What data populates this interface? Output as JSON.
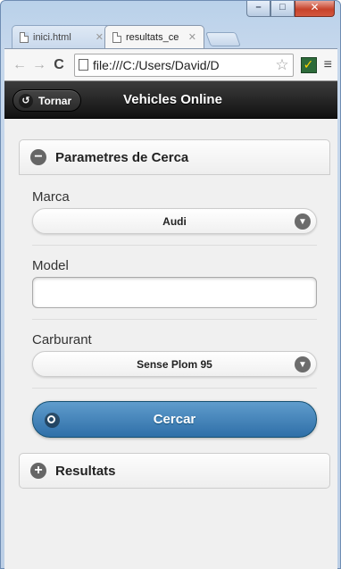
{
  "browser": {
    "tabs": [
      {
        "title": "inici.html",
        "active": false
      },
      {
        "title": "resultats_ce",
        "active": true
      }
    ],
    "url": "file:///C:/Users/David/D",
    "window_controls": {
      "minimize": "–",
      "maximize": "□",
      "close": "✕"
    }
  },
  "app": {
    "back_label": "Tornar",
    "title": "Vehicles Online"
  },
  "search_panel": {
    "header": "Parametres de Cerca",
    "icon": "minus-icon",
    "fields": {
      "marca": {
        "label": "Marca",
        "value": "Audi"
      },
      "model": {
        "label": "Model",
        "value": ""
      },
      "carburant": {
        "label": "Carburant",
        "value": "Sense Plom 95"
      }
    },
    "button_label": "Cercar"
  },
  "results_panel": {
    "header": "Resultats",
    "icon": "plus-icon"
  },
  "colors": {
    "header_bg": "#1e1e1e",
    "button_blue": "#3d7fb8",
    "page_bg": "#f0f0f0"
  }
}
